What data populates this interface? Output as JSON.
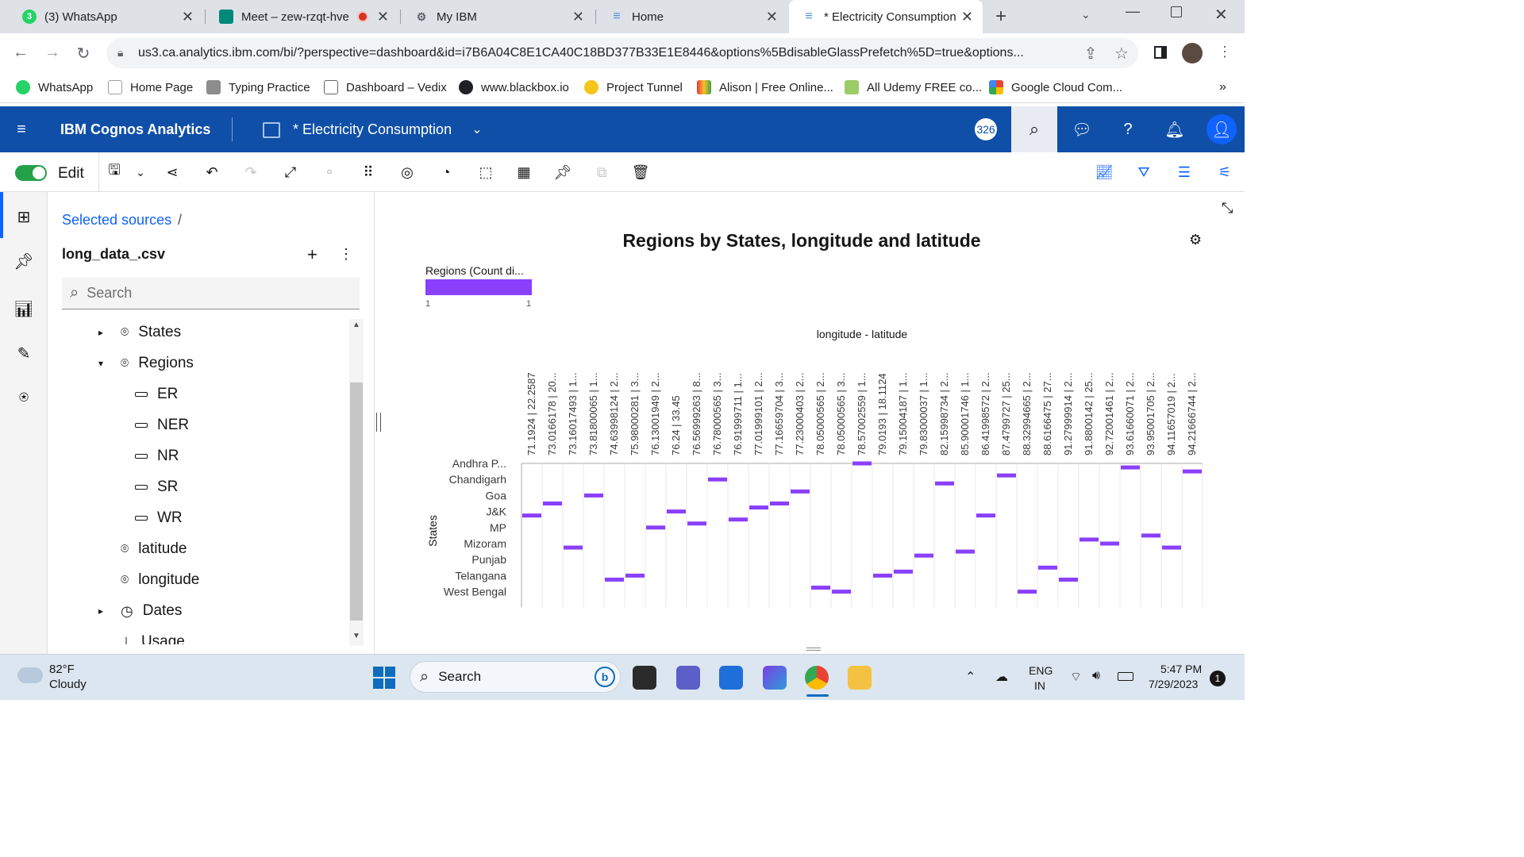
{
  "browser": {
    "tabs": [
      {
        "title": "(3) WhatsApp",
        "fav_color": "#25d366",
        "fav_text": "3"
      },
      {
        "title": "Meet – zew-rzqt-hve",
        "fav_color": "#00897b",
        "fav_text": ""
      },
      {
        "title": "My IBM",
        "fav_color": "#5f6368",
        "fav_text": ""
      },
      {
        "title": "Home",
        "fav_color": "#4a90d9",
        "fav_text": ""
      },
      {
        "title": "* Electricity Consumption",
        "fav_color": "#4a90d9",
        "fav_text": ""
      }
    ],
    "url": "us3.ca.analytics.ibm.com/bi/?perspective=dashboard&id=i7B6A04C8E1CA40C18BD377B33E1E8446&options%5BdisableGlassPrefetch%5D=true&options...",
    "bookmarks": [
      "WhatsApp",
      "Home Page",
      "Typing Practice",
      "Dashboard – Vedix",
      "www.blackbox.io",
      "Project Tunnel",
      "Alison | Free Online...",
      "All Udemy FREE co...",
      "Google Cloud Com..."
    ],
    "more_bookmarks": "»"
  },
  "app": {
    "brand": "IBM Cognos Analytics",
    "dashboard_title": "* Electricity Consumption",
    "badge": "326",
    "edit_label": "Edit"
  },
  "sources": {
    "breadcrumb": "Selected sources",
    "breadcrumb_sep": "/",
    "file": "long_data_.csv",
    "search_placeholder": "Search",
    "tree": [
      {
        "label": "States",
        "level": 0,
        "caret": "▸",
        "icon": "pin"
      },
      {
        "label": "Regions",
        "level": 0,
        "caret": "▾",
        "icon": "pin"
      },
      {
        "label": "ER",
        "level": 1,
        "caret": "",
        "icon": "member"
      },
      {
        "label": "NER",
        "level": 1,
        "caret": "",
        "icon": "member"
      },
      {
        "label": "NR",
        "level": 1,
        "caret": "",
        "icon": "member"
      },
      {
        "label": "SR",
        "level": 1,
        "caret": "",
        "icon": "member"
      },
      {
        "label": "WR",
        "level": 1,
        "caret": "",
        "icon": "member"
      },
      {
        "label": "latitude",
        "level": 0,
        "caret": "",
        "icon": "pin"
      },
      {
        "label": "longitude",
        "level": 0,
        "caret": "",
        "icon": "pin"
      },
      {
        "label": "Dates",
        "level": 0,
        "caret": "▸",
        "icon": "clock"
      },
      {
        "label": "Usage",
        "level": 0,
        "caret": "",
        "icon": "measure"
      }
    ]
  },
  "chart_data": {
    "type": "heatmap",
    "title": "Regions by States, longitude and latitude",
    "legend_title": "Regions (Count di...",
    "legend_min": "1",
    "legend_max": "1",
    "legend_color": "#8a3ffc",
    "xlabel": "longitude - latitude",
    "ylabel": "States",
    "y_categories": [
      "Andhra P...",
      "Chandigarh",
      "Goa",
      "J&K",
      "MP",
      "Mizoram",
      "Punjab",
      "Telangana",
      "West Bengal"
    ],
    "x_categories": [
      "71.1924 | 22.2587",
      "73.0166178 | 20...",
      "73.16017493 | 1...",
      "73.81800065 | 1...",
      "74.63998124 | 2...",
      "75.98000281 | 3...",
      "76.13001949 | 2...",
      "76.24 | 33.45",
      "76.56999263 | 8...",
      "76.78000565 | 3...",
      "76.91999711 | 1...",
      "77.01999101 | 2...",
      "77.16659704 | 3...",
      "77.23000403 | 2...",
      "78.05000565 | 2...",
      "78.05000565 | 3...",
      "78.57002559 | 1...",
      "79.0193 | 18.1124",
      "79.15004187 | 1...",
      "79.83000037 | 1...",
      "82.15998734 | 2...",
      "85.90001746 | 1...",
      "86.41998572 | 2...",
      "87.4799727 | 25...",
      "88.32994665 | 2...",
      "88.6166475 | 27...",
      "91.27999914 | 2...",
      "91.8800142 | 25...",
      "92.72001461 | 2...",
      "93.61660071 | 2...",
      "93.95001705 | 2...",
      "94.11657019 | 2...",
      "94.21666744 | 2..."
    ],
    "cells": [
      [
        0,
        3.25
      ],
      [
        1,
        2.5
      ],
      [
        2,
        5.25
      ],
      [
        3,
        2.0
      ],
      [
        4,
        7.25
      ],
      [
        5,
        7.0
      ],
      [
        6,
        4.0
      ],
      [
        7,
        3.0
      ],
      [
        8,
        3.75
      ],
      [
        9,
        1.0
      ],
      [
        10,
        3.5
      ],
      [
        11,
        2.75
      ],
      [
        12,
        2.5
      ],
      [
        13,
        1.75
      ],
      [
        14,
        7.75
      ],
      [
        15,
        8.0
      ],
      [
        16,
        0.0
      ],
      [
        17,
        7.0
      ],
      [
        18,
        6.75
      ],
      [
        19,
        5.75
      ],
      [
        20,
        1.25
      ],
      [
        21,
        5.5
      ],
      [
        22,
        3.25
      ],
      [
        23,
        0.75
      ],
      [
        24,
        8.0
      ],
      [
        25,
        6.5
      ],
      [
        26,
        7.25
      ],
      [
        27,
        4.75
      ],
      [
        28,
        5.0
      ],
      [
        29,
        0.25
      ],
      [
        30,
        4.5
      ],
      [
        31,
        5.25
      ],
      [
        32,
        0.5
      ]
    ]
  },
  "taskbar": {
    "weather_temp": "82°F",
    "weather_desc": "Cloudy",
    "search_label": "Search",
    "lang_top": "ENG",
    "lang_bottom": "IN",
    "time": "5:47 PM",
    "date": "7/29/2023",
    "notifications": "1"
  }
}
